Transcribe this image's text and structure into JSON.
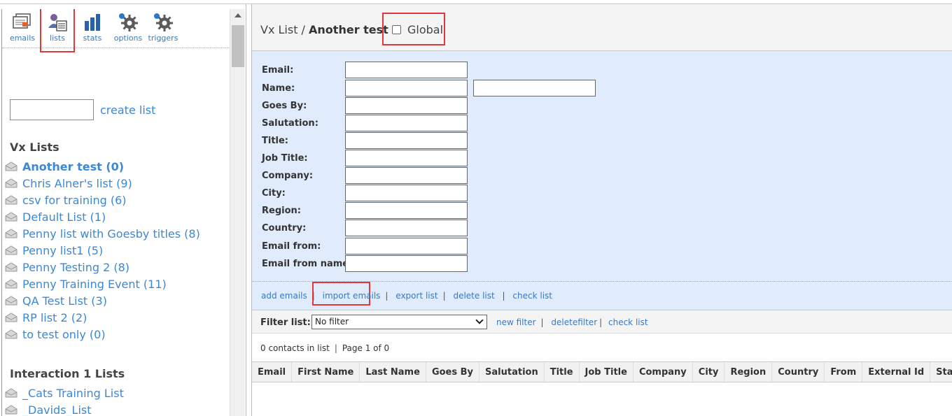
{
  "toolbar": {
    "items": [
      {
        "label": "emails",
        "icon": "emails-icon"
      },
      {
        "label": "lists",
        "icon": "lists-icon"
      },
      {
        "label": "stats",
        "icon": "stats-icon"
      },
      {
        "label": "options",
        "icon": "gear-icon"
      },
      {
        "label": "triggers",
        "icon": "gear-icon"
      }
    ]
  },
  "sidebar": {
    "create_label": "create list",
    "vx_title": "Vx Lists",
    "vx_lists": [
      "Another test (0)",
      "Chris Alner's list (9)",
      "csv for training (6)",
      "Default List (1)",
      "Penny list with Goesby titles (8)",
      "Penny list1 (5)",
      "Penny Testing 2 (8)",
      "Penny Training Event (11)",
      "QA Test List (3)",
      "RP list 2 (2)",
      "to test only (0)"
    ],
    "interaction_title": "Interaction 1 Lists",
    "interaction_lists": [
      "_Cats Training List",
      "_Davids_List"
    ]
  },
  "header": {
    "crumb_prefix": "Vx List / ",
    "crumb_current": "Another test",
    "global_label": "Global"
  },
  "form": {
    "fields": [
      "Email:",
      "Name:",
      "Goes By:",
      "Salutation:",
      "Title:",
      "Job Title:",
      "Company:",
      "City:",
      "Region:",
      "Country:",
      "Email from:",
      "Email from name:"
    ]
  },
  "actions": [
    "add emails",
    "import emails",
    "export list",
    "delete list",
    "check list"
  ],
  "filter": {
    "label": "Filter list:",
    "selected": "No filter",
    "links": [
      "new filter",
      "deletefilter",
      "check list"
    ]
  },
  "summary": {
    "contacts": "0 contacts in list",
    "page": "Page 1 of 0"
  },
  "table": {
    "columns": [
      "Email",
      "First Name",
      "Last Name",
      "Goes By",
      "Salutation",
      "Title",
      "Job Title",
      "Company",
      "City",
      "Region",
      "Country",
      "From",
      "External Id",
      "Status"
    ]
  },
  "colors": {
    "link": "#3a88d6",
    "highlight": "#e0393b",
    "form_bg": "#e0ebfb"
  }
}
